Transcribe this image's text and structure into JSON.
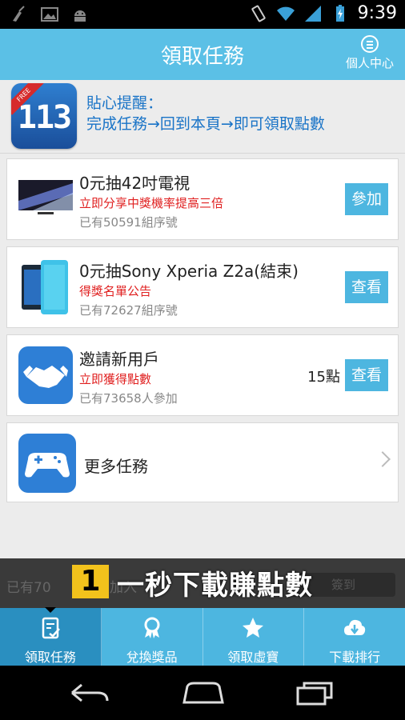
{
  "status_bar": {
    "time": "9:39",
    "icons": [
      "broom-icon",
      "image-icon",
      "android-icon",
      "vibrate-icon",
      "wifi-icon",
      "signal-icon",
      "battery-charging-icon"
    ]
  },
  "header": {
    "title": "領取任務",
    "personal_center_label": "個人中心"
  },
  "reminder": {
    "logo_text": "113",
    "logo_ribbon": "FREE",
    "line1": "貼心提醒：",
    "line2": "完成任務→回到本頁→即可領取點數"
  },
  "tasks": [
    {
      "name": "0元抽42吋電視",
      "subtitle": "立即分享中獎機率提高三倍",
      "count": "已有50591組序號",
      "button": "參加",
      "thumb": "tv-thumbnail"
    },
    {
      "name": "0元抽Sony Xperia Z2a(結束)",
      "subtitle": "得獎名單公告",
      "count": "已有72627組序號",
      "button": "查看",
      "thumb": "phone-thumbnail"
    },
    {
      "name": "邀請新用戶",
      "subtitle": "立即獲得點數",
      "count": "已有73658人參加",
      "points": "15點",
      "button": "查看",
      "thumb": "handshake-icon"
    }
  ],
  "more_tasks": {
    "label": "更多任務"
  },
  "banner": {
    "ghost_text_1": "已有70",
    "ghost_text_2": "員加入",
    "ghost_button": "簽到",
    "badge": "1",
    "slogan": "一秒下載賺點數"
  },
  "bottom_nav": [
    {
      "label": "領取任務",
      "icon": "task-checklist-icon",
      "active": true
    },
    {
      "label": "兌換獎品",
      "icon": "award-ribbon-icon",
      "active": false
    },
    {
      "label": "領取虛寶",
      "icon": "star-icon",
      "active": false
    },
    {
      "label": "下載排行",
      "icon": "cloud-download-icon",
      "active": false
    }
  ],
  "colors": {
    "header_bg": "#5bc0e6",
    "accent_button": "#4db6e0",
    "red_text": "#e02020",
    "reminder_blue": "#1a74c7",
    "banner_badge": "#f2c21c"
  }
}
